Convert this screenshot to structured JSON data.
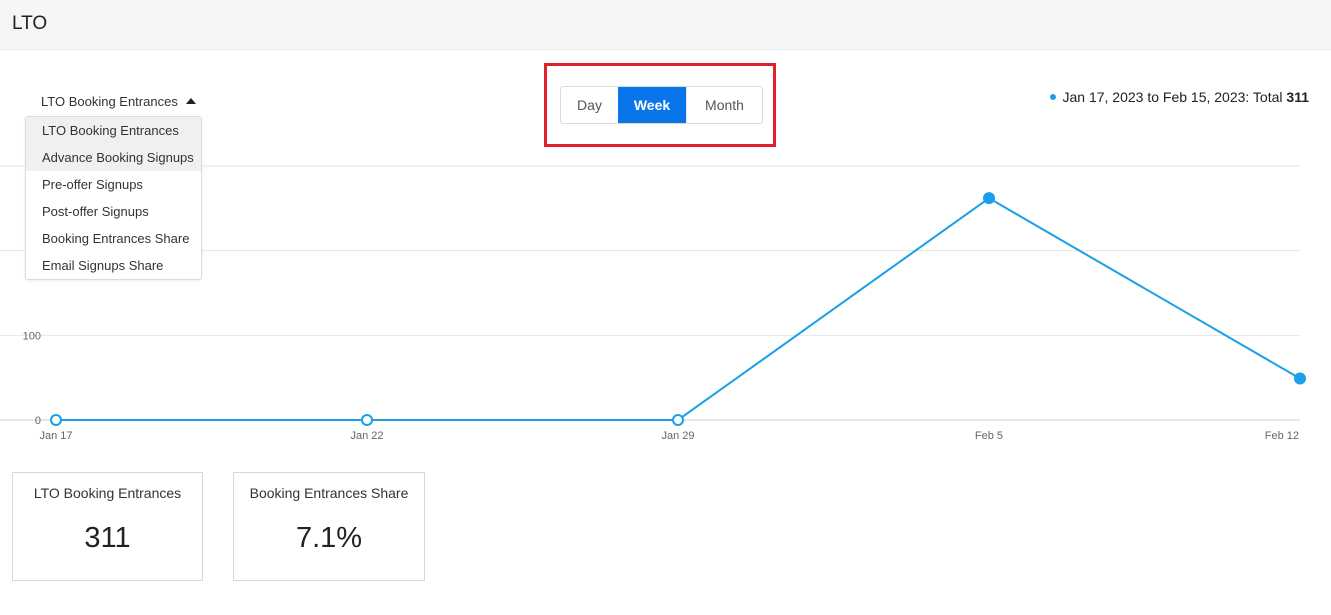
{
  "header": {
    "title": "LTO"
  },
  "metric_selector": {
    "selected": "LTO Booking Entrances",
    "options": [
      "LTO Booking Entrances",
      "Advance Booking Signups",
      "Pre-offer Signups",
      "Post-offer Signups",
      "Booking Entrances Share",
      "Email Signups Share"
    ]
  },
  "period_toggle": {
    "day": "Day",
    "week": "Week",
    "month": "Month",
    "active": "Week"
  },
  "legend": {
    "range_text": "Jan 17, 2023 to Feb 15, 2023: Total ",
    "total": "311"
  },
  "colors": {
    "series": "#1aa0e6",
    "accent": "#0a74ea",
    "highlight": "#e0202e"
  },
  "chart_data": {
    "type": "line",
    "categories": [
      "Jan 17",
      "Jan 22",
      "Jan 29",
      "Feb 5",
      "Feb 12"
    ],
    "series": [
      {
        "name": "",
        "values": [
          0,
          0,
          0,
          262,
          49
        ]
      }
    ],
    "y_ticks": [
      "0",
      "100"
    ],
    "ylim": [
      0,
      300
    ],
    "grid": true
  },
  "cards": [
    {
      "label": "LTO Booking Entrances",
      "value": "311"
    },
    {
      "label": "Booking Entrances Share",
      "value": "7.1%"
    }
  ]
}
